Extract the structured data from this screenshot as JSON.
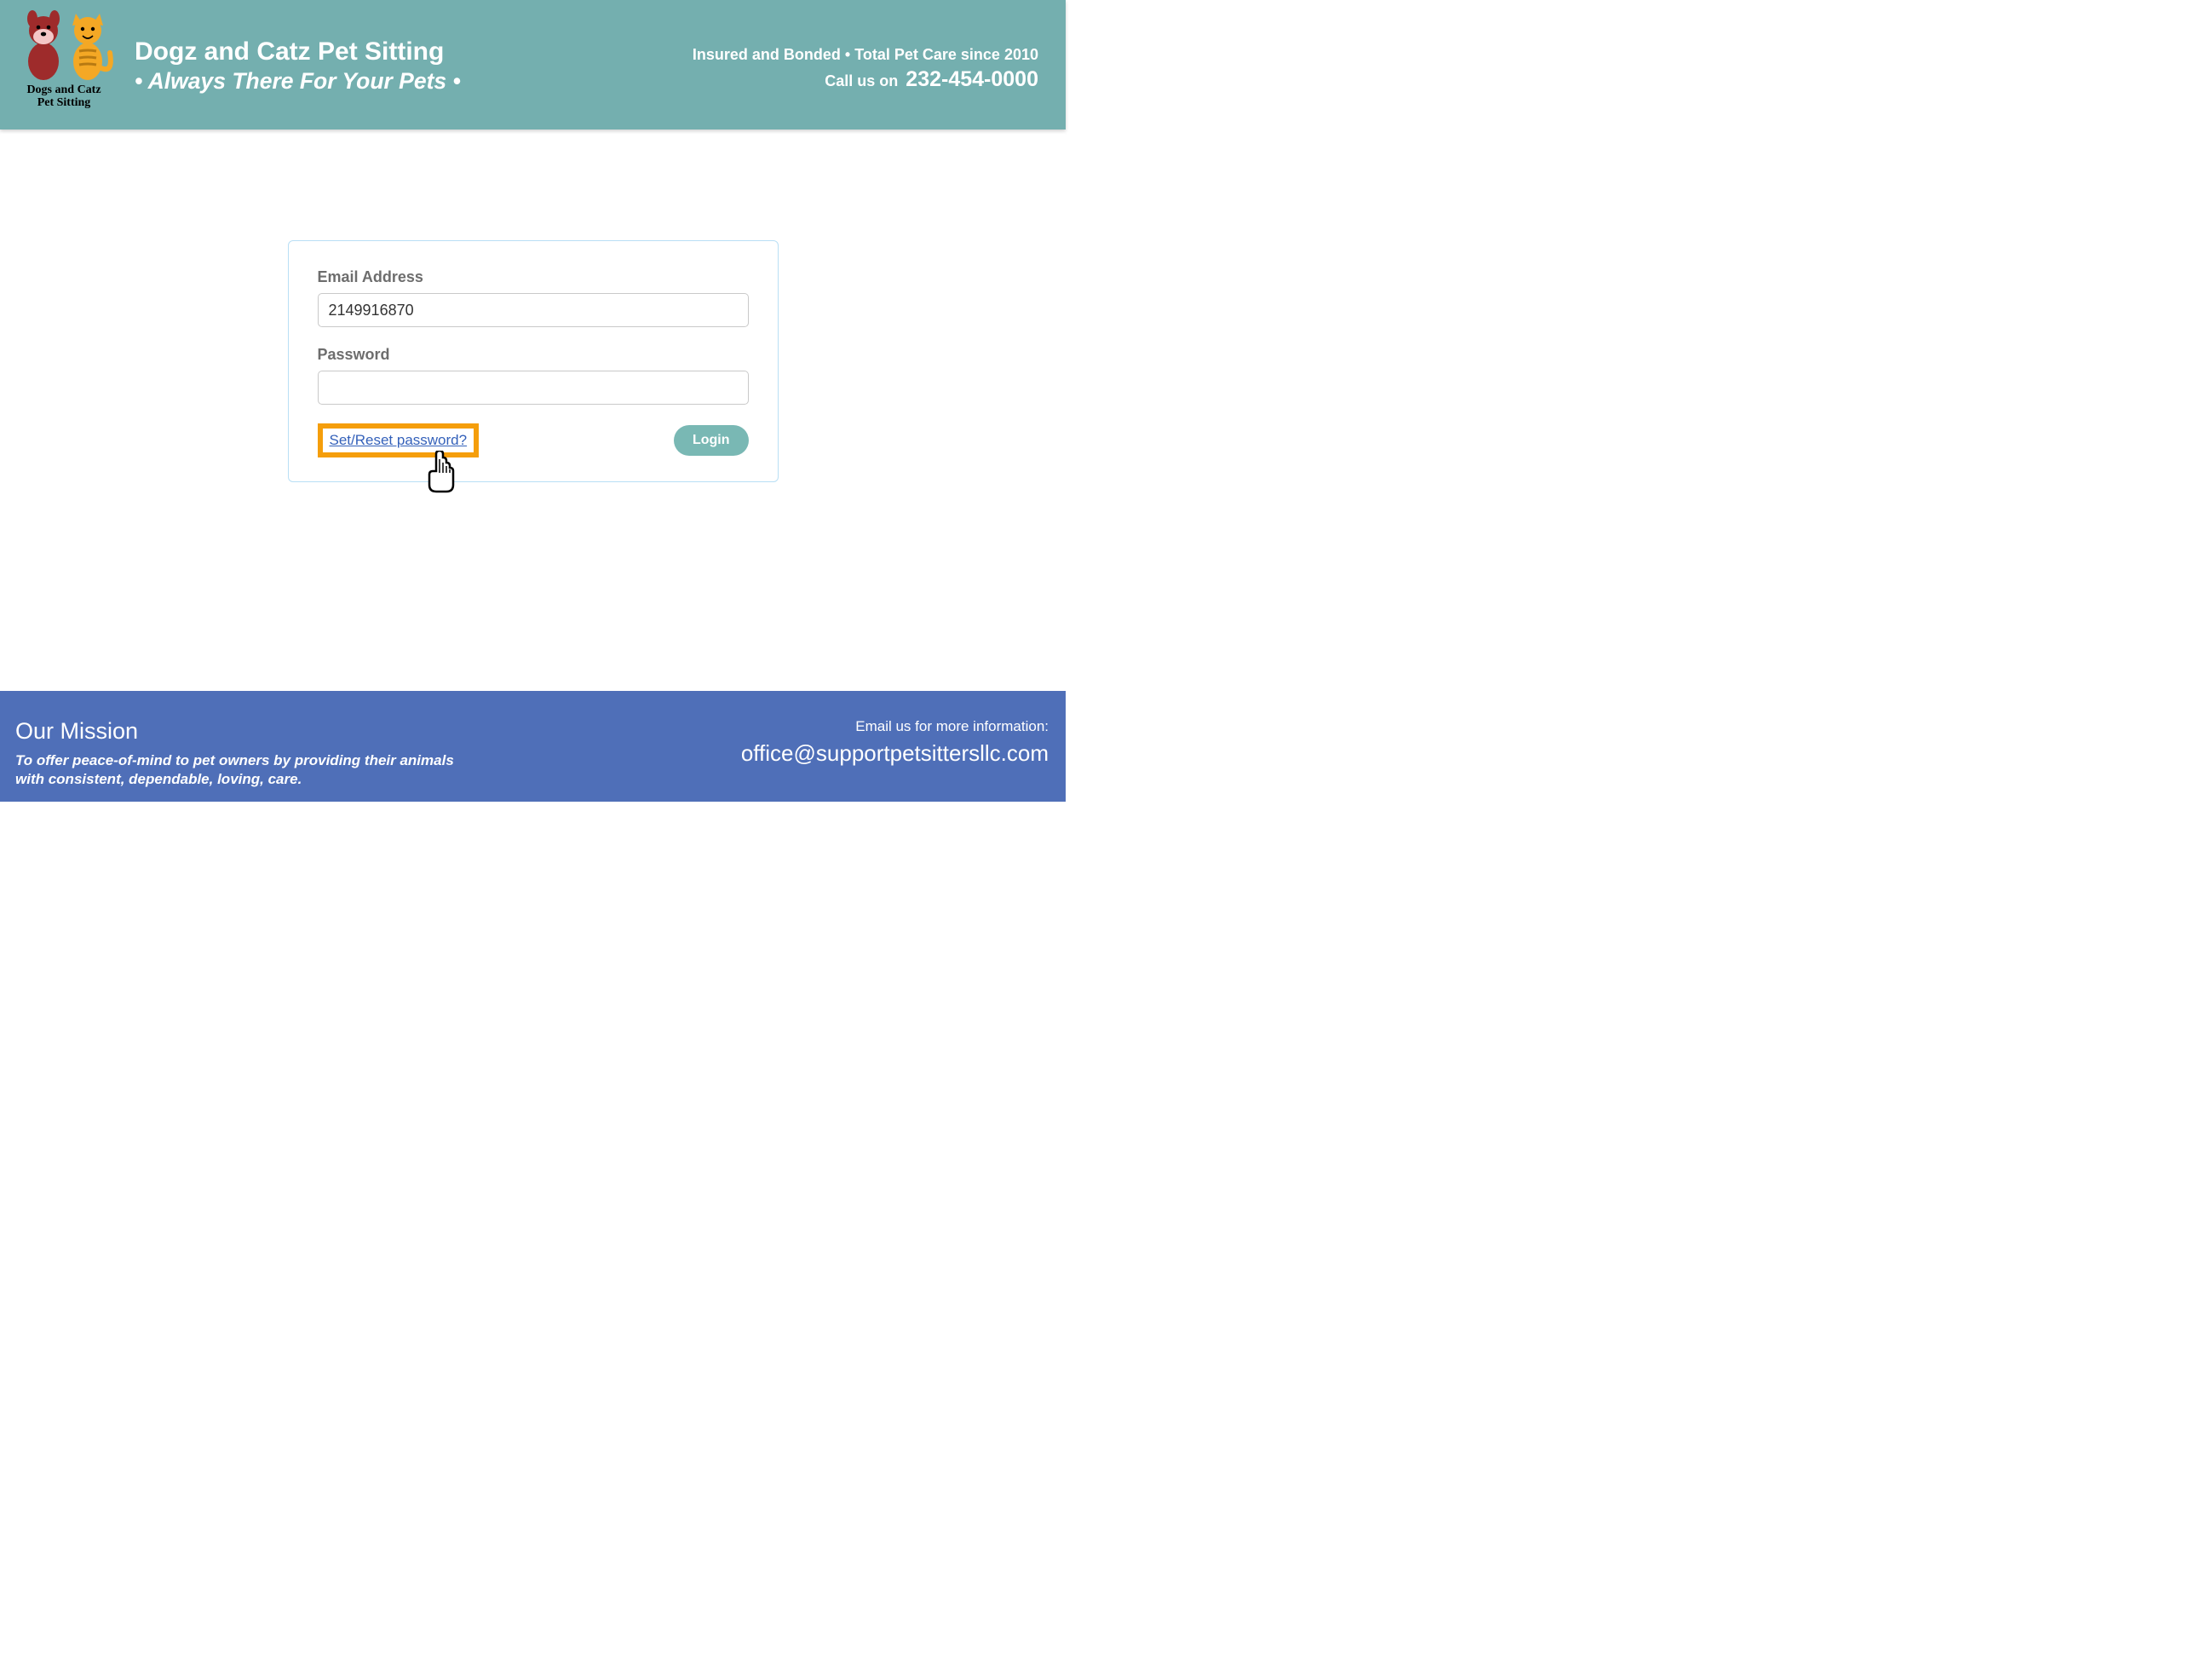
{
  "header": {
    "logo_line1": "Dogs and Catz",
    "logo_line2": "Pet Sitting",
    "brand_name": "Dogz and Catz Pet Sitting",
    "brand_tagline": "• Always There For Your Pets •",
    "info_line1": "Insured and Bonded • Total Pet Care since 2010",
    "call_prefix": "Call us on ",
    "phone": "232-454-0000"
  },
  "login": {
    "email_label": "Email Address",
    "email_value": "2149916870",
    "password_label": "Password",
    "password_value": "",
    "reset_link": "Set/Reset password?",
    "login_button": "Login"
  },
  "footer": {
    "mission_title": "Our Mission",
    "mission_text": "To offer peace-of-mind to pet owners by providing their animals with consistent, dependable, loving, care.",
    "email_cta": "Email us for more information:",
    "email": "office@supportpetsittersllc.com"
  }
}
